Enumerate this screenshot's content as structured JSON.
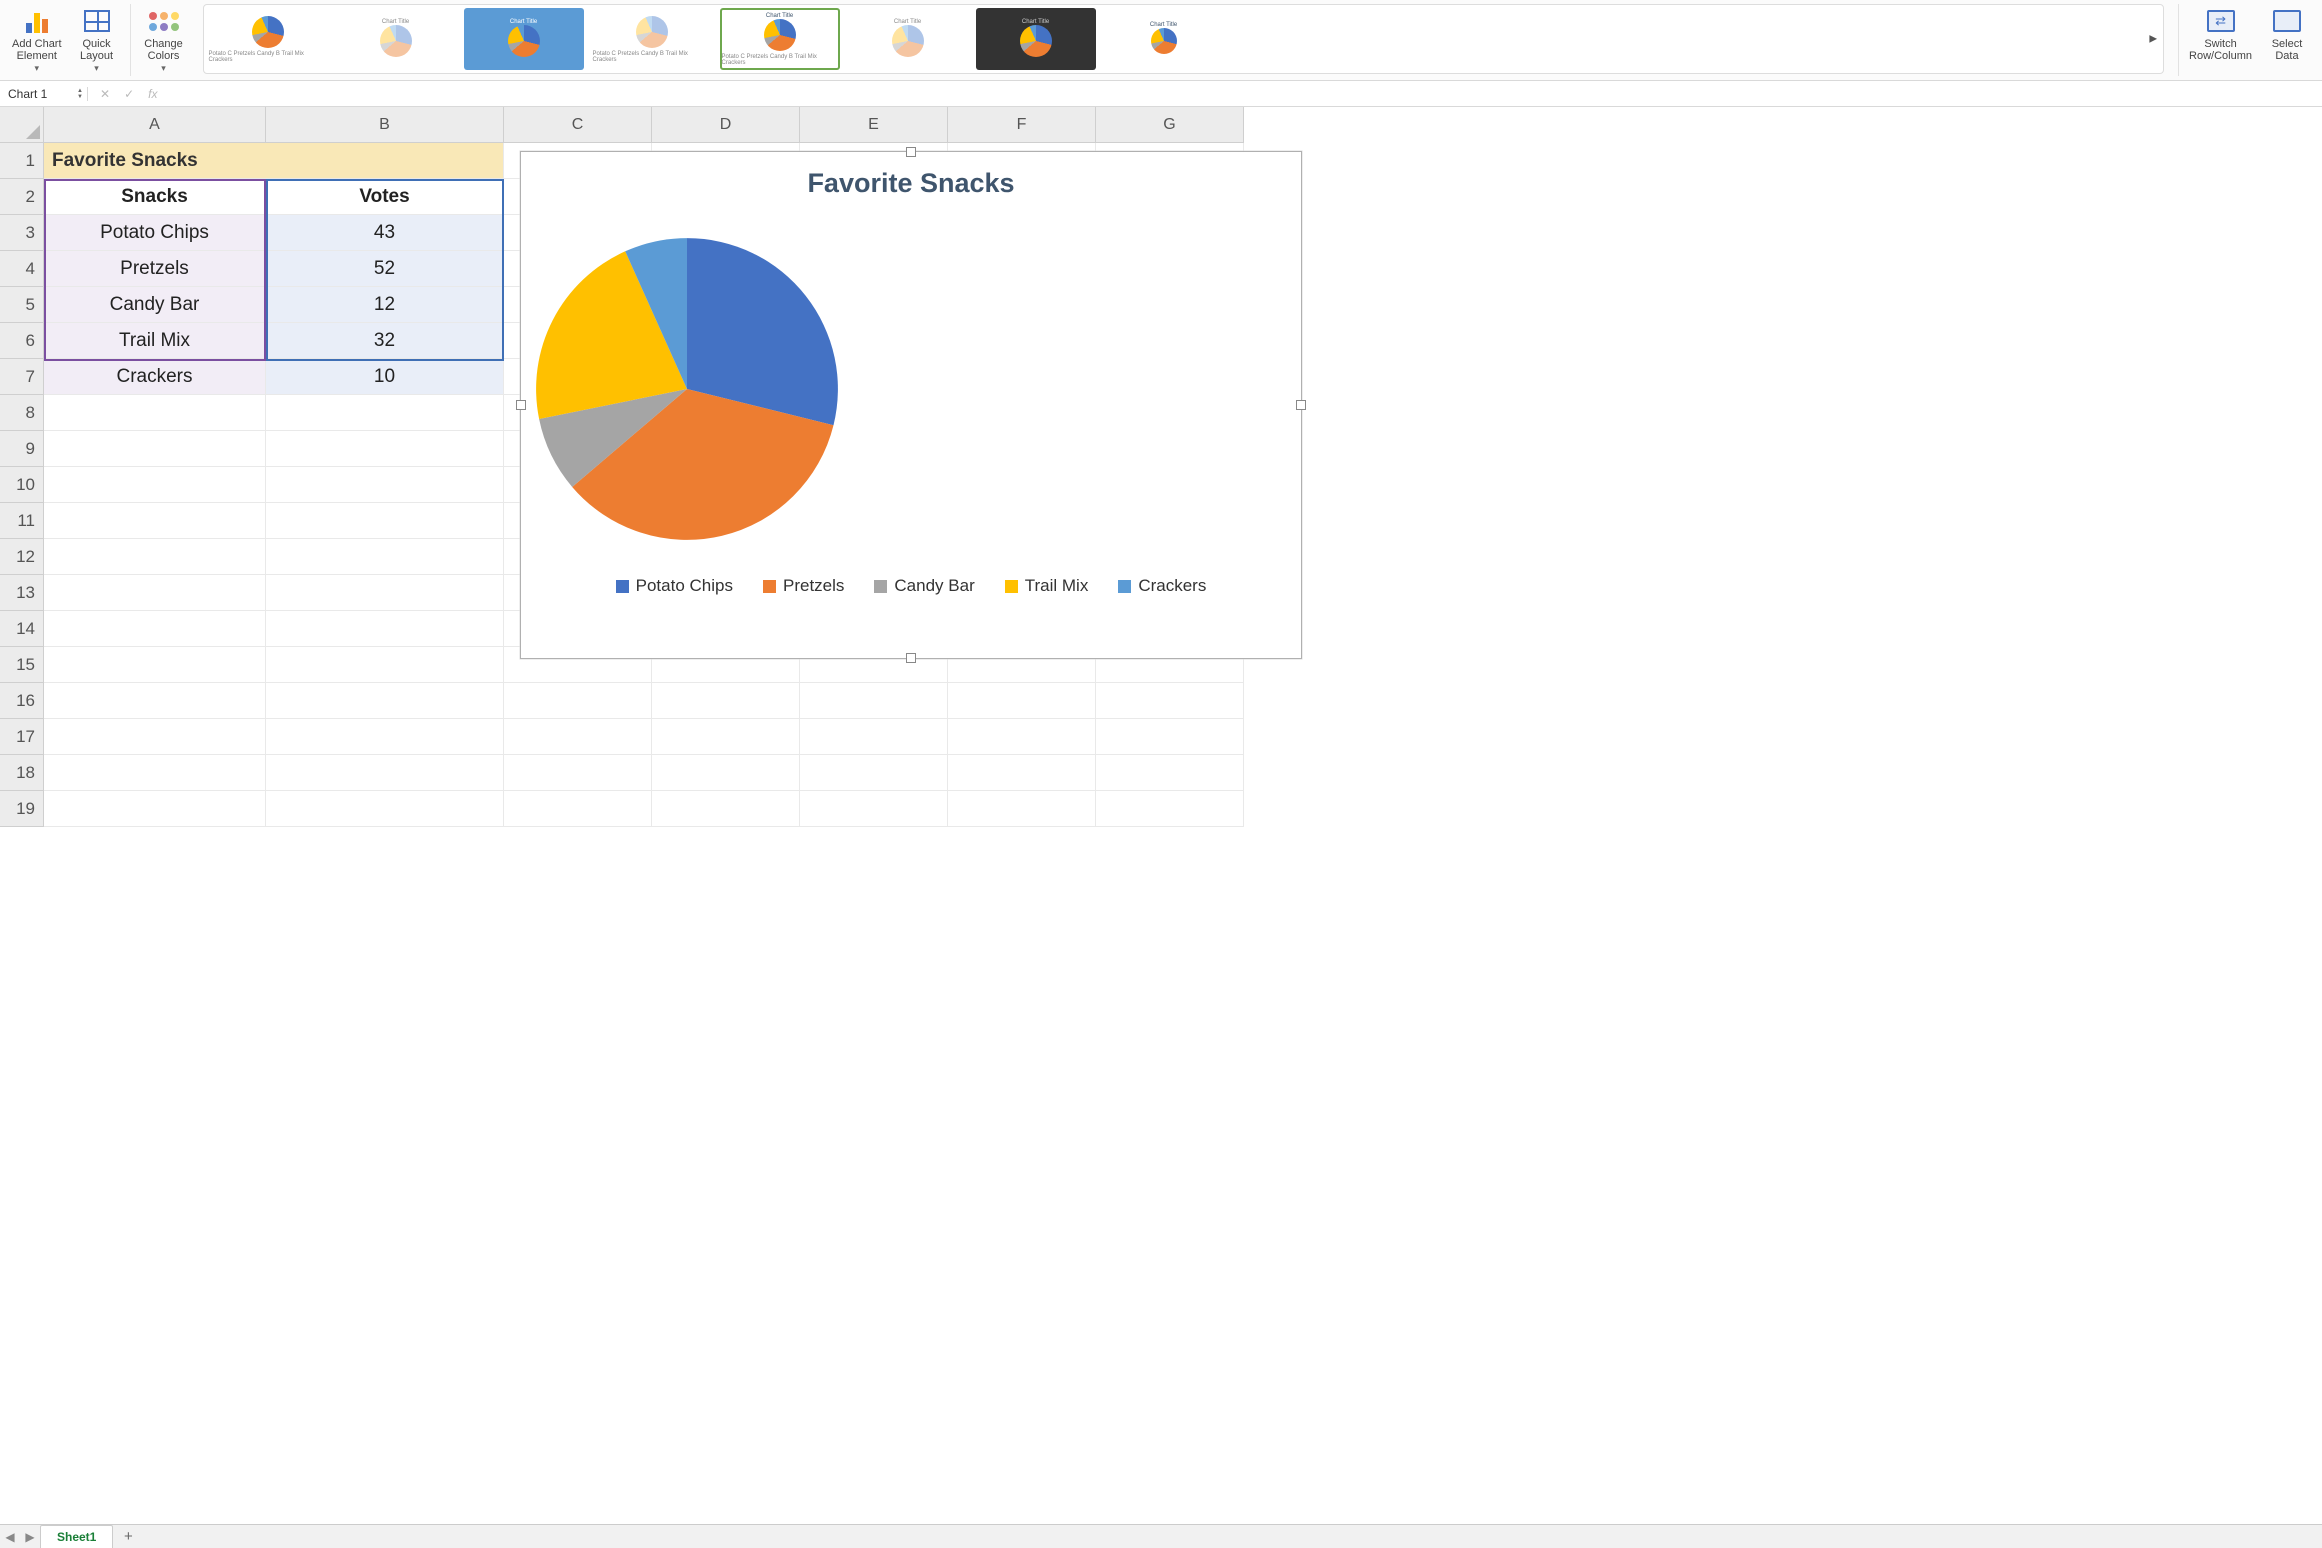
{
  "ribbon": {
    "add_chart_element": "Add Chart\nElement",
    "quick_layout": "Quick\nLayout",
    "change_colors": "Change\nColors",
    "switch_row_col": "Switch\nRow/Column",
    "select_data": "Select\nData",
    "style_thumb_label": "Chart Title",
    "style_thumb_legend": "Potato C  Pretzels  Candy B  Trail Mix  Crackers"
  },
  "name_box": "Chart 1",
  "fx_label": "fx",
  "columns": [
    "A",
    "B",
    "C",
    "D",
    "E",
    "F",
    "G"
  ],
  "rows": [
    "1",
    "2",
    "3",
    "4",
    "5",
    "6",
    "7",
    "8",
    "9",
    "10",
    "11",
    "12",
    "13",
    "14",
    "15",
    "16",
    "17",
    "18",
    "19"
  ],
  "data": {
    "title": "Favorite Snacks",
    "col_a_header": "Snacks",
    "col_b_header": "Votes",
    "rows": [
      {
        "snack": "Potato Chips",
        "votes": 43
      },
      {
        "snack": "Pretzels",
        "votes": 52
      },
      {
        "snack": "Candy Bar",
        "votes": 12
      },
      {
        "snack": "Trail Mix",
        "votes": 32
      },
      {
        "snack": "Crackers",
        "votes": 10
      }
    ]
  },
  "chart_data": {
    "type": "pie",
    "title": "Favorite Snacks",
    "categories": [
      "Potato Chips",
      "Pretzels",
      "Candy Bar",
      "Trail Mix",
      "Crackers"
    ],
    "values": [
      43,
      52,
      12,
      32,
      10
    ],
    "colors": [
      "#4472C4",
      "#ED7D31",
      "#A5A5A5",
      "#FFC000",
      "#5B9BD5"
    ],
    "legend_position": "bottom"
  },
  "sheet_tab": "Sheet1"
}
